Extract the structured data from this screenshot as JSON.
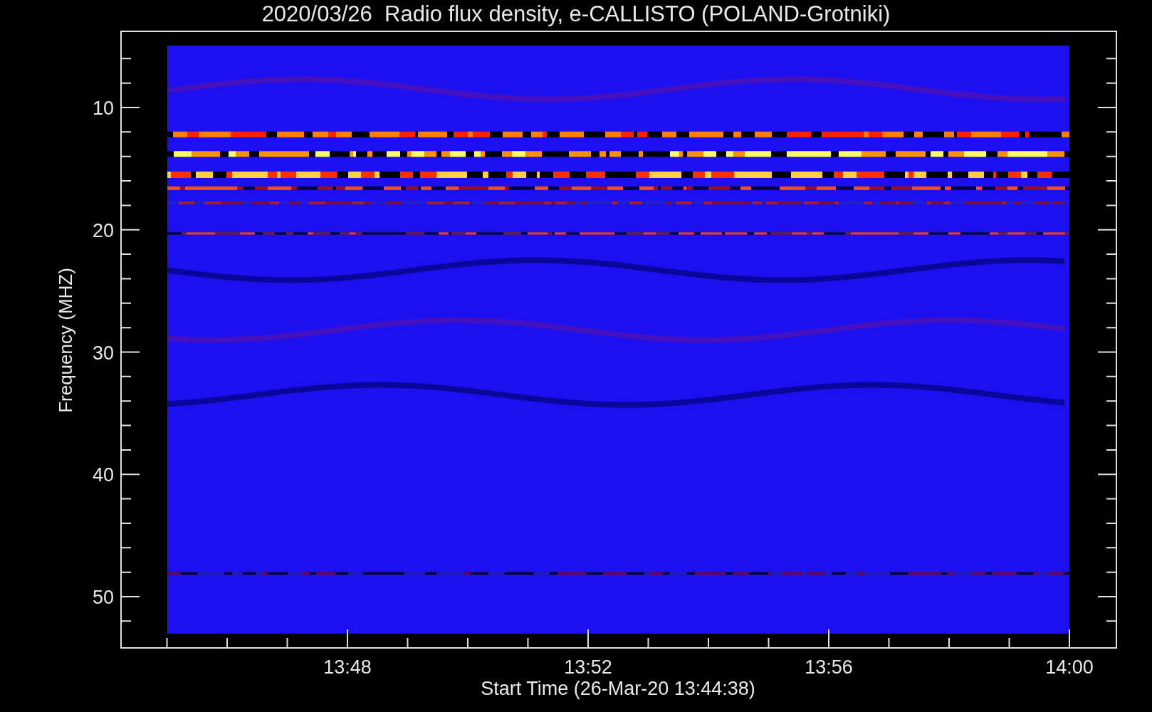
{
  "title": "2020/03/26  Radio flux density, e-CALLISTO (POLAND-Grotniki)",
  "y_axis": {
    "label": "Frequency (MHZ)",
    "ticks": [
      "10",
      "20",
      "30",
      "40",
      "50"
    ]
  },
  "x_axis": {
    "label": "Start Time (26-Mar-20 13:44:38)",
    "ticks": [
      "13:48",
      "13:52",
      "13:56",
      "14:00"
    ]
  }
}
